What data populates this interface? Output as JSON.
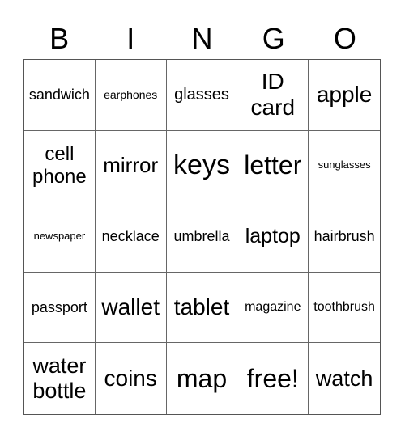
{
  "header": {
    "letters": [
      "B",
      "I",
      "N",
      "G",
      "O"
    ]
  },
  "card": {
    "cells": [
      "sandwich",
      "earphones",
      "glasses",
      "ID card",
      "apple",
      "cell phone",
      "mirror",
      "keys",
      "letter",
      "sunglasses",
      "newspaper",
      "necklace",
      "umbrella",
      "laptop",
      "hairbrush",
      "passport",
      "wallet",
      "tablet",
      "magazine",
      "toothbrush",
      "water bottle",
      "coins",
      "map",
      "free!",
      "watch"
    ]
  }
}
